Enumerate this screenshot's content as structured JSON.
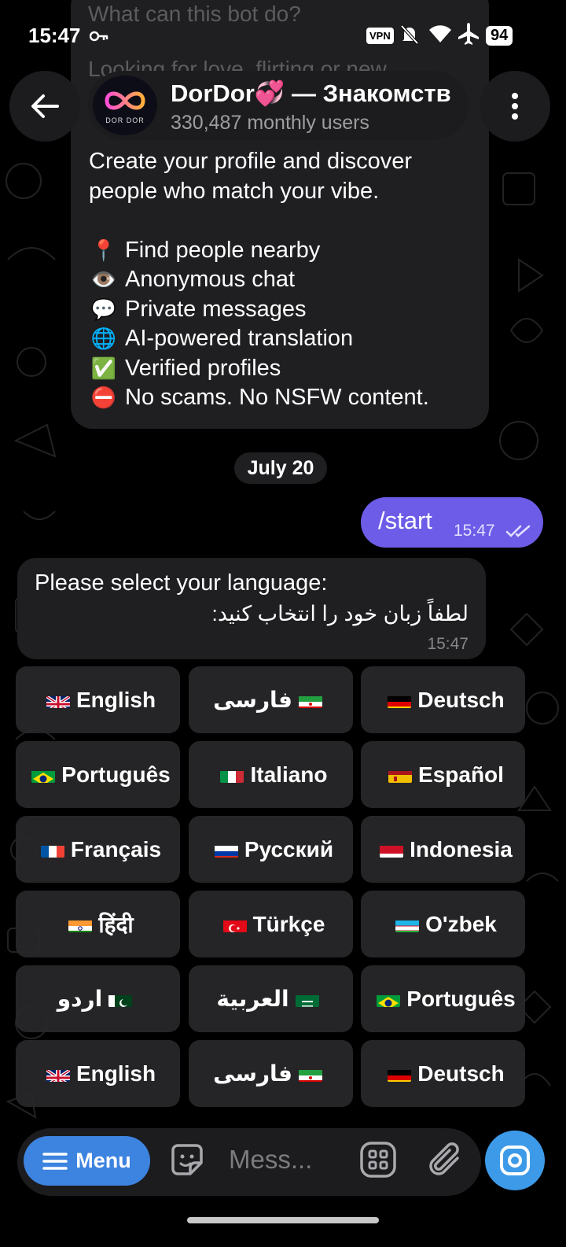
{
  "status_bar": {
    "time": "15:47",
    "vpn": "VPN",
    "battery": "94"
  },
  "header": {
    "title": "DorDor💞 — Знакомств",
    "subtitle": "330,487 monthly users",
    "avatar_text": "DOR DOR"
  },
  "chat": {
    "bot_info": {
      "ghost_line1": "What can this bot do?",
      "ghost_line2": "Looking for love, flirting or new",
      "intro_line1": "Create your profile and discover",
      "intro_line2": "people who match your vibe.",
      "features": [
        {
          "icon": "pin-icon",
          "emoji": "📍",
          "text": "Find people nearby"
        },
        {
          "icon": "eye-icon",
          "emoji": "👁️",
          "text": "Anonymous chat"
        },
        {
          "icon": "speech-bubble-icon",
          "emoji": "💬",
          "text": "Private messages"
        },
        {
          "icon": "globe-icon",
          "emoji": "🌐",
          "text": "AI-powered translation"
        },
        {
          "icon": "check-icon",
          "emoji": "✅",
          "text": "Verified profiles"
        },
        {
          "icon": "no-entry-icon",
          "emoji": "⛔",
          "text": "No scams. No NSFW content."
        }
      ]
    },
    "date_chip": "July 20",
    "outgoing": {
      "text": "/start",
      "time": "15:47"
    },
    "incoming": {
      "line1": "Please select your language:",
      "line2": "لطفاً زبان خود را انتخاب کنید:",
      "time": "15:47"
    }
  },
  "keyboard": {
    "rows": [
      [
        {
          "label": "English",
          "flag": "gb"
        },
        {
          "label": "فارسی",
          "flag": "ir",
          "rtl": true
        },
        {
          "label": "Deutsch",
          "flag": "de"
        }
      ],
      [
        {
          "label": "Português",
          "flag": "br"
        },
        {
          "label": "Italiano",
          "flag": "it"
        },
        {
          "label": "Español",
          "flag": "es"
        }
      ],
      [
        {
          "label": "Français",
          "flag": "fr"
        },
        {
          "label": "Русский",
          "flag": "ru"
        },
        {
          "label": "Indonesia",
          "flag": "id"
        }
      ],
      [
        {
          "label": "हिंदी",
          "flag": "in"
        },
        {
          "label": "Türkçe",
          "flag": "tr"
        },
        {
          "label": "O'zbek",
          "flag": "uz"
        }
      ],
      [
        {
          "label": "اردو",
          "flag": "pk",
          "rtl": true
        },
        {
          "label": "العربية",
          "flag": "sa",
          "rtl": true
        },
        {
          "label": "Português",
          "flag": "br"
        }
      ],
      [
        {
          "label": "English",
          "flag": "gb"
        },
        {
          "label": "فارسی",
          "flag": "ir",
          "rtl": true
        },
        {
          "label": "Deutsch",
          "flag": "de"
        }
      ]
    ]
  },
  "composer": {
    "menu_label": "Menu",
    "placeholder": "Mess..."
  },
  "colors": {
    "accent_blue": "#3d83e0",
    "outgoing_bubble": "#6c5ce7",
    "incoming_bubble": "#1f1f21",
    "background": "#000000"
  }
}
